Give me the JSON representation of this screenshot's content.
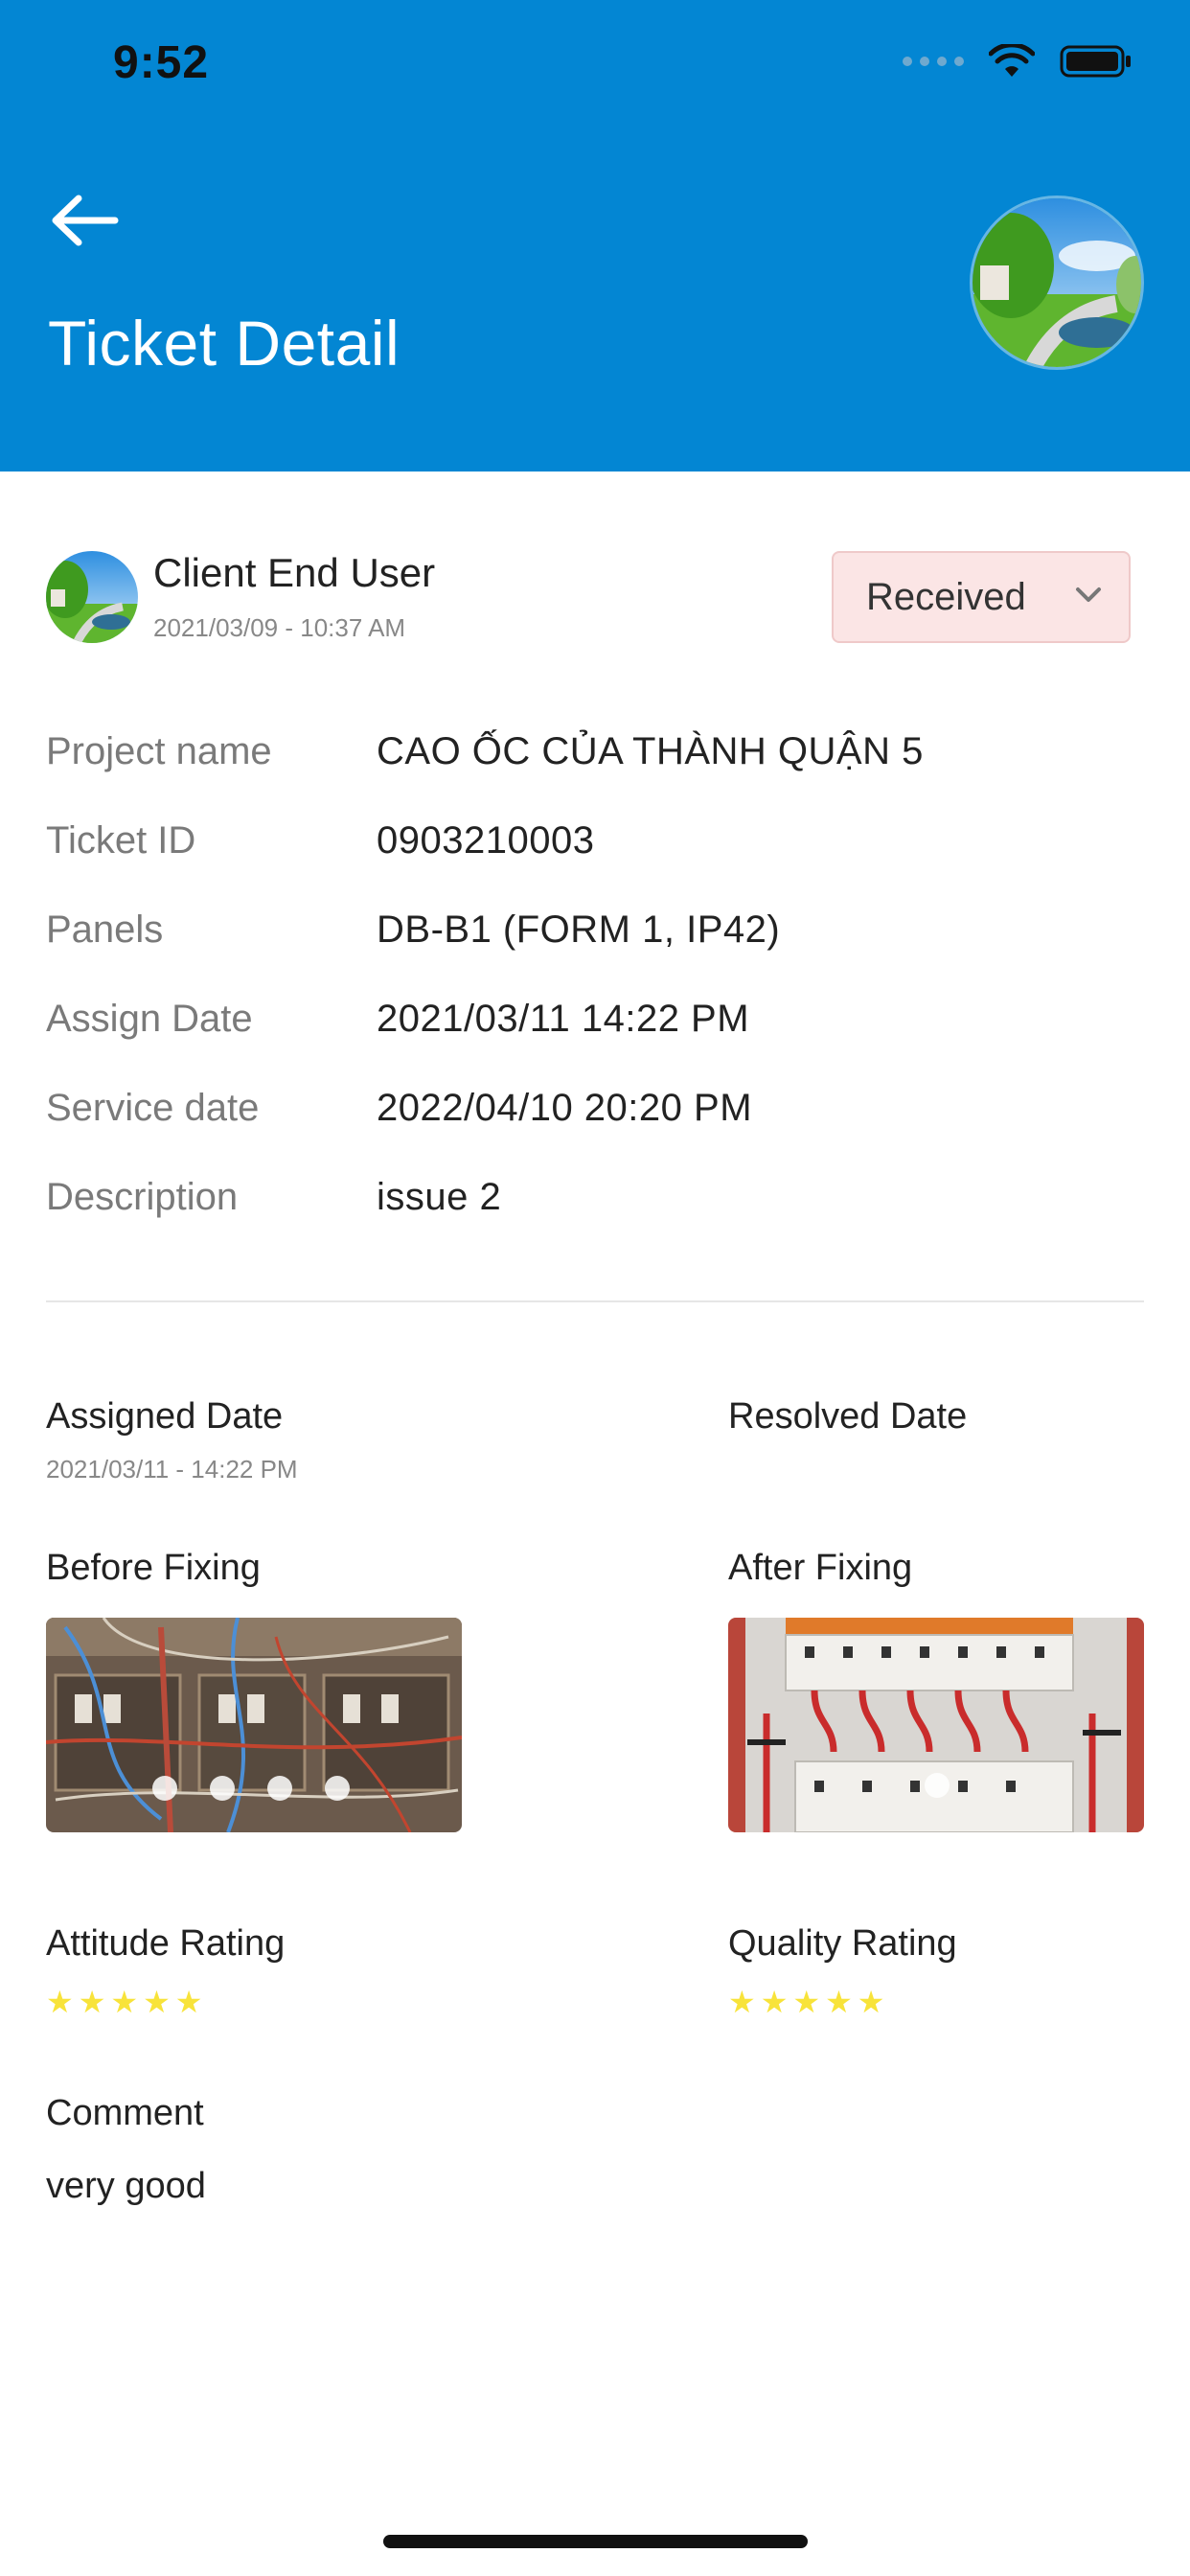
{
  "status_bar": {
    "time": "9:52"
  },
  "header": {
    "title": "Ticket Detail"
  },
  "user": {
    "name": "Client End User",
    "timestamp": "2021/03/09 - 10:37 AM"
  },
  "status": {
    "selected": "Received"
  },
  "details": [
    {
      "label": "Project name",
      "value": "CAO ỐC CỦA THÀNH QUẬN 5"
    },
    {
      "label": "Ticket ID",
      "value": "0903210003"
    },
    {
      "label": "Panels",
      "value": "DB-B1 (FORM 1, IP42)"
    },
    {
      "label": "Assign Date",
      "value": "2021/03/11 14:22 PM"
    },
    {
      "label": "Service date",
      "value": "2022/04/10 20:20 PM"
    },
    {
      "label": "Description",
      "value": "issue 2"
    }
  ],
  "assigned": {
    "label": "Assigned Date",
    "value": "2021/03/11 - 14:22 PM"
  },
  "resolved": {
    "label": "Resolved Date"
  },
  "before_fixing": {
    "label": "Before Fixing",
    "pages": 4
  },
  "after_fixing": {
    "label": "After Fixing",
    "pages": 1
  },
  "attitude_rating": {
    "label": "Attitude Rating",
    "stars": 5,
    "max": 5
  },
  "quality_rating": {
    "label": "Quality Rating",
    "stars": 5,
    "max": 5
  },
  "comment": {
    "label": "Comment",
    "value": "very good"
  },
  "colors": {
    "header": "#0386d3",
    "star": "#f8e33a",
    "status_bg": "#fbe5e5"
  },
  "icons": [
    "back-arrow-icon",
    "wifi-icon",
    "battery-icon",
    "chevron-down-icon",
    "star-icon"
  ]
}
